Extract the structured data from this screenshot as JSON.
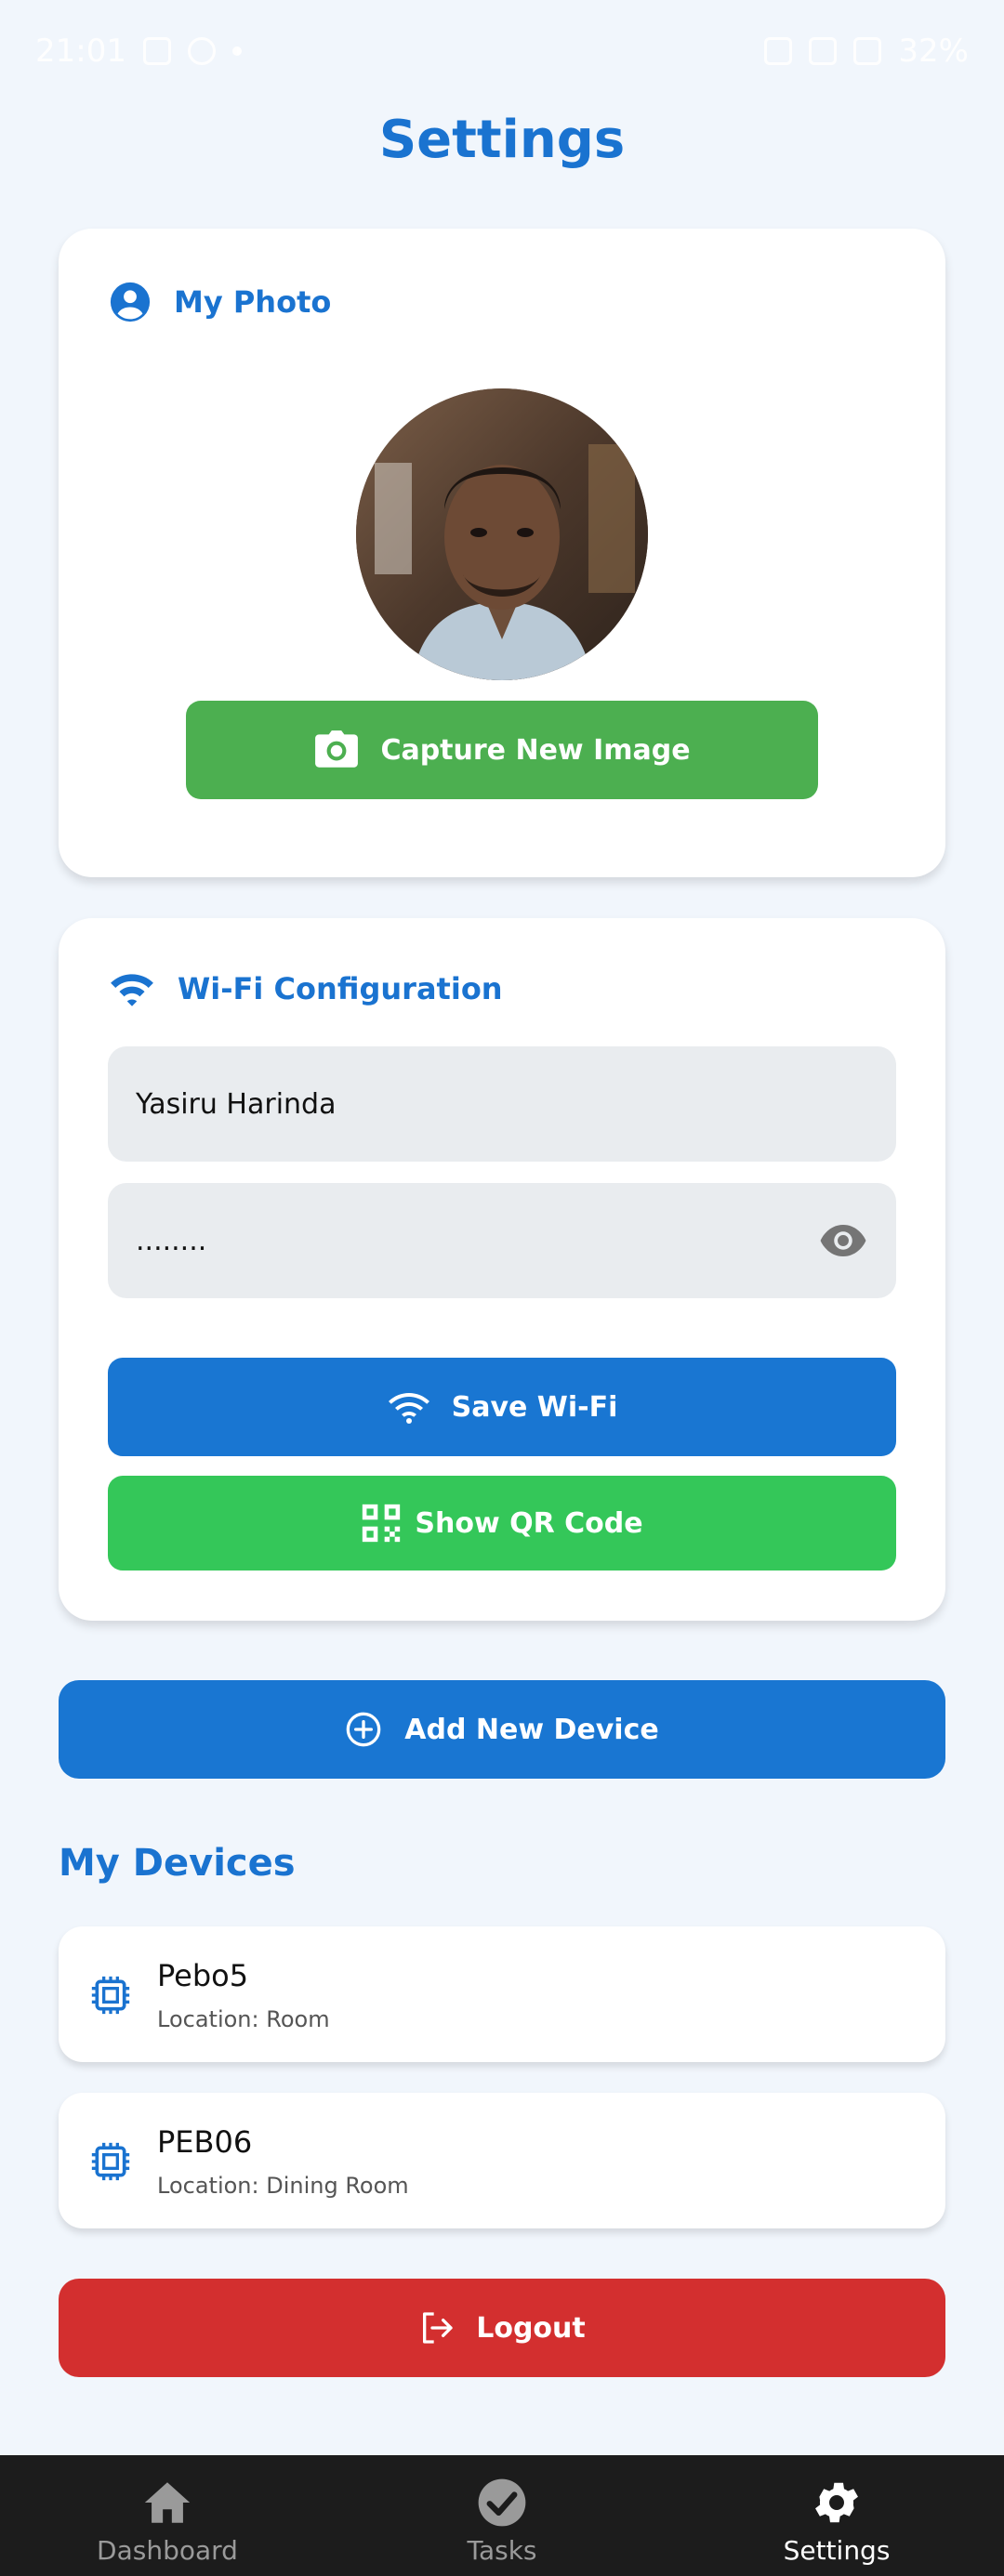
{
  "status_bar": {
    "time": "21:01",
    "battery": "32%"
  },
  "page": {
    "title": "Settings"
  },
  "photo_section": {
    "title": "My Photo",
    "capture_label": "Capture New Image"
  },
  "wifi_section": {
    "title": "Wi-Fi Configuration",
    "ssid_value": "Yasiru Harinda",
    "password_value": "........",
    "save_label": "Save Wi-Fi",
    "qr_label": "Show QR Code"
  },
  "add_device_label": "Add New Device",
  "devices": {
    "title": "My Devices",
    "items": [
      {
        "name": "Pebo5",
        "location": "Location: Room"
      },
      {
        "name": "PEB06",
        "location": "Location: Dining Room"
      }
    ]
  },
  "logout_label": "Logout",
  "nav": {
    "items": [
      {
        "label": "Dashboard",
        "icon": "home-icon"
      },
      {
        "label": "Tasks",
        "icon": "check-circle-icon"
      },
      {
        "label": "Settings",
        "icon": "gear-icon"
      }
    ],
    "active_index": 2
  },
  "colors": {
    "accent": "#1a73d0",
    "capture_green": "#4caf50",
    "qr_green": "#34c759",
    "logout_red": "#d32f2f",
    "nav_bg": "#1c1c1c",
    "page_bg": "#f1f6fc"
  }
}
